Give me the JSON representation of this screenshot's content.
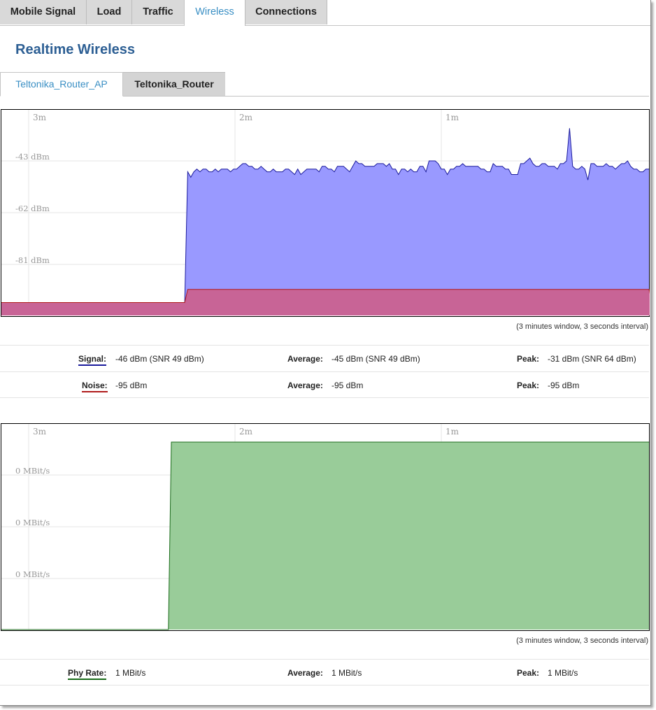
{
  "tabs": [
    "Mobile Signal",
    "Load",
    "Traffic",
    "Wireless",
    "Connections"
  ],
  "active_tab": "Wireless",
  "page_title": "Realtime Wireless",
  "sub_tabs": [
    "Teltonika_Router_AP",
    "Teltonika_Router"
  ],
  "active_sub_tab": "Teltonika_Router_AP",
  "colors": {
    "accent": "#3a8fc4",
    "title": "#2d5f94",
    "signal_line": "#1a1a9c",
    "signal_fill": "#9999ff",
    "noise_line": "#b01b1b",
    "noise_fill": "#c86496",
    "rate_line": "#1a6b1a",
    "rate_fill": "#99cc99"
  },
  "signal_graph": {
    "time_labels": [
      "3m",
      "2m",
      "1m"
    ],
    "y_labels": [
      "-43 dBm",
      "-62 dBm",
      "-81 dBm"
    ],
    "window_note": "(3 minutes window, 3 seconds interval)"
  },
  "signal_stats": {
    "signal_label": "Signal:",
    "signal_value": "-46 dBm (SNR 49 dBm)",
    "signal_avg_label": "Average:",
    "signal_avg_value": "-45 dBm (SNR 49 dBm)",
    "signal_peak_label": "Peak:",
    "signal_peak_value": "-31 dBm (SNR 64 dBm)",
    "noise_label": "Noise:",
    "noise_value": "-95 dBm",
    "noise_avg_label": "Average:",
    "noise_avg_value": "-95 dBm",
    "noise_peak_label": "Peak:",
    "noise_peak_value": "-95 dBm"
  },
  "rate_graph": {
    "time_labels": [
      "3m",
      "2m",
      "1m"
    ],
    "y_labels": [
      "0 MBit/s",
      "0 MBit/s",
      "0 MBit/s"
    ],
    "window_note": "(3 minutes window, 3 seconds interval)"
  },
  "rate_stats": {
    "rate_label": "Phy Rate:",
    "rate_value": "1 MBit/s",
    "rate_avg_label": "Average:",
    "rate_avg_value": "1 MBit/s",
    "rate_peak_label": "Peak:",
    "rate_peak_value": "1 MBit/s"
  },
  "chart_data": [
    {
      "type": "area",
      "x_unit": "samples (3 s interval)",
      "ylabel": "",
      "series": [
        {
          "name": "Signal",
          "values": [
            -95,
            -95,
            -95,
            -95,
            -95,
            -95,
            -95,
            -95,
            -95,
            -95,
            -95,
            -95,
            -95,
            -95,
            -95,
            -95,
            -95,
            -95,
            -95,
            -95,
            -95,
            -95,
            -95,
            -95,
            -95,
            -95,
            -95,
            -95,
            -95,
            -95,
            -95,
            -95,
            -95,
            -95,
            -95,
            -95,
            -95,
            -95,
            -95,
            -95,
            -95,
            -95,
            -95,
            -95,
            -95,
            -95,
            -95,
            -95,
            -95,
            -95,
            -95,
            -95,
            -95,
            -95,
            -95,
            -95,
            -95,
            -95,
            -95,
            -95,
            -95,
            -47,
            -49,
            -47,
            -46,
            -47,
            -46,
            -46,
            -47,
            -47,
            -46,
            -47,
            -46,
            -46,
            -46,
            -47,
            -46,
            -46,
            -45,
            -44,
            -44,
            -45,
            -45,
            -46,
            -46,
            -45,
            -46,
            -47,
            -47,
            -46,
            -47,
            -47,
            -47,
            -46,
            -46,
            -47,
            -48,
            -46,
            -48,
            -47,
            -46,
            -46,
            -46,
            -46,
            -47,
            -45,
            -45,
            -46,
            -46,
            -47,
            -45,
            -45,
            -45,
            -46,
            -47,
            -45,
            -43,
            -44,
            -44,
            -45,
            -45,
            -45,
            -45,
            -44,
            -44,
            -44,
            -45,
            -44,
            -46,
            -46,
            -48,
            -46,
            -46,
            -47,
            -46,
            -47,
            -47,
            -45,
            -45,
            -47,
            -43,
            -43,
            -43,
            -44,
            -46,
            -46,
            -48,
            -46,
            -46,
            -45,
            -45,
            -44,
            -45,
            -45,
            -45,
            -45,
            -45,
            -46,
            -46,
            -47,
            -47,
            -44,
            -45,
            -45,
            -45,
            -46,
            -46,
            -48,
            -48,
            -48,
            -44,
            -44,
            -43,
            -42,
            -44,
            -45,
            -45,
            -44,
            -44,
            -45,
            -45,
            -45,
            -46,
            -44,
            -44,
            -43,
            -31,
            -45,
            -46,
            -46,
            -45,
            -46,
            -50,
            -44,
            -44,
            -45,
            -45,
            -45,
            -44,
            -45,
            -45,
            -46,
            -45,
            -44,
            -44,
            -43,
            -45,
            -46,
            -46,
            -47,
            -47,
            -46,
            -46
          ]
        },
        {
          "name": "Noise",
          "values": [
            -95,
            -95,
            -95,
            -95,
            -95,
            -95,
            -95,
            -95,
            -95,
            -95,
            -95,
            -95,
            -95,
            -95,
            -95,
            -95,
            -95,
            -95,
            -95,
            -95,
            -95,
            -95,
            -95,
            -95,
            -95,
            -95,
            -95,
            -95,
            -95,
            -95,
            -95,
            -95,
            -95,
            -95,
            -95,
            -95,
            -95,
            -95,
            -95,
            -95,
            -95,
            -95,
            -95,
            -95,
            -95,
            -95,
            -95,
            -95,
            -95,
            -95,
            -95,
            -95,
            -95,
            -95,
            -95,
            -95,
            -95,
            -95,
            -95,
            -95,
            -95,
            -95,
            -95,
            -95,
            -95,
            -95,
            -95,
            -95,
            -95,
            -95,
            -95,
            -95,
            -95,
            -95,
            -95,
            -95,
            -95,
            -95,
            -95,
            -95,
            -95,
            -95,
            -95,
            -95,
            -95,
            -95,
            -95,
            -95,
            -95,
            -95,
            -95,
            -95,
            -95,
            -95,
            -95,
            -95,
            -95,
            -95,
            -95,
            -95,
            -95,
            -95,
            -95,
            -95,
            -95,
            -95,
            -95,
            -95,
            -95,
            -95,
            -95,
            -95,
            -95,
            -95,
            -95,
            -95,
            -95,
            -95,
            -95,
            -95,
            -95,
            -95,
            -95,
            -95,
            -95,
            -95,
            -95,
            -95,
            -95,
            -95,
            -95,
            -95,
            -95,
            -95,
            -95,
            -95,
            -95,
            -95,
            -95,
            -95,
            -95,
            -95,
            -95,
            -95,
            -95,
            -95,
            -95,
            -95,
            -95,
            -95,
            -95,
            -95,
            -95,
            -95,
            -95,
            -95,
            -95,
            -95,
            -95,
            -95,
            -95,
            -95,
            -95,
            -95,
            -95,
            -95,
            -95,
            -95,
            -95,
            -95,
            -95,
            -95,
            -95,
            -95,
            -95,
            -95,
            -95,
            -95,
            -95,
            -95,
            -95,
            -95,
            -95,
            -95,
            -95,
            -95,
            -95,
            -95,
            -95,
            -95,
            -95,
            -95,
            -95,
            -95,
            -95,
            -95,
            -95,
            -95,
            -95,
            -95,
            -95,
            -95,
            -95,
            -95,
            -95,
            -95,
            -95,
            -95,
            -95,
            -95,
            -95,
            -95,
            -95,
            -95,
            -95,
            -95,
            -95
          ]
        }
      ],
      "x_tick_labels": [
        "3m",
        "2m",
        "1m"
      ],
      "y_tick_labels": [
        "-43 dBm",
        "-62 dBm",
        "-81 dBm"
      ],
      "grid": true
    },
    {
      "type": "area",
      "x_unit": "samples (3 s interval)",
      "series": [
        {
          "name": "Phy Rate",
          "values_mbit": [
            0,
            0,
            0,
            0,
            0,
            0,
            0,
            0,
            0,
            0,
            0,
            0,
            0,
            0,
            0,
            0,
            0,
            0,
            0,
            0,
            0,
            0,
            0,
            0,
            0,
            0,
            0,
            0,
            0,
            0,
            0,
            0,
            0,
            0,
            0,
            0,
            0,
            0,
            0,
            0,
            0,
            0,
            0,
            0,
            0,
            0,
            0,
            0,
            0,
            0,
            0,
            0,
            0,
            0,
            0,
            0,
            0,
            0,
            1,
            1,
            1,
            1,
            1,
            1,
            1,
            1,
            1,
            1,
            1,
            1,
            1,
            1,
            1,
            1,
            1,
            1,
            1,
            1,
            1,
            1,
            1,
            1,
            1,
            1,
            1,
            1,
            1,
            1,
            1,
            1,
            1,
            1,
            1,
            1,
            1,
            1,
            1,
            1,
            1,
            1,
            1,
            1,
            1,
            1,
            1,
            1,
            1,
            1,
            1,
            1,
            1,
            1,
            1,
            1,
            1,
            1,
            1,
            1,
            1,
            1,
            1,
            1,
            1,
            1,
            1,
            1,
            1,
            1,
            1,
            1,
            1,
            1,
            1,
            1,
            1,
            1,
            1,
            1,
            1,
            1,
            1,
            1,
            1,
            1,
            1,
            1,
            1,
            1,
            1,
            1,
            1,
            1,
            1,
            1,
            1,
            1,
            1,
            1,
            1,
            1,
            1,
            1,
            1,
            1,
            1,
            1,
            1,
            1,
            1,
            1,
            1,
            1,
            1,
            1,
            1,
            1,
            1,
            1,
            1,
            1,
            1,
            1,
            1,
            1,
            1,
            1,
            1,
            1,
            1,
            1,
            1,
            1,
            1,
            1,
            1,
            1,
            1,
            1,
            1,
            1,
            1,
            1,
            1,
            1,
            1,
            1,
            1,
            1,
            1,
            1,
            1,
            1,
            1,
            1,
            1,
            1,
            1,
            1,
            1,
            1,
            1,
            1
          ]
        }
      ],
      "x_tick_labels": [
        "3m",
        "2m",
        "1m"
      ],
      "y_tick_labels": [
        "0 MBit/s",
        "0 MBit/s",
        "0 MBit/s"
      ],
      "grid": true
    }
  ]
}
